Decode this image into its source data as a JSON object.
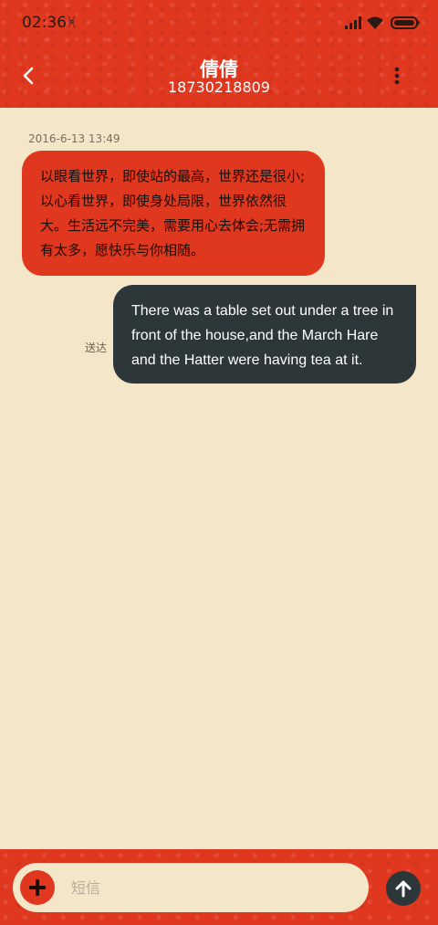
{
  "status_bar": {
    "time": "02:36",
    "bluetooth_icon": "bluetooth-icon",
    "signal_icon": "signal-icon",
    "wifi_icon": "wifi-icon",
    "battery_icon": "battery-icon"
  },
  "header": {
    "title": "倩倩",
    "subtitle": "18730218809",
    "back_icon": "chevron-left-icon",
    "menu_icon": "more-vertical-icon"
  },
  "conversation": {
    "timestamp": "2016-6-13 13:49",
    "messages": [
      {
        "direction": "incoming",
        "text": "以眼看世界，即使站的最高，世界还是很小;以心看世界，即使身处局限，世界依然很大。生活远不完美，需要用心去体会;无需拥有太多，愿快乐与你相随。"
      },
      {
        "direction": "outgoing",
        "text": "There was a table set out under a tree in front of the house,and the March Hare and the Hatter were having tea at it.",
        "status": "送达"
      }
    ]
  },
  "composer": {
    "placeholder": "短信",
    "value": "",
    "add_icon": "plus-icon",
    "send_icon": "arrow-up-icon"
  },
  "colors": {
    "accent": "#e0371f",
    "background": "#f4e6c8",
    "dark": "#2d3638"
  }
}
